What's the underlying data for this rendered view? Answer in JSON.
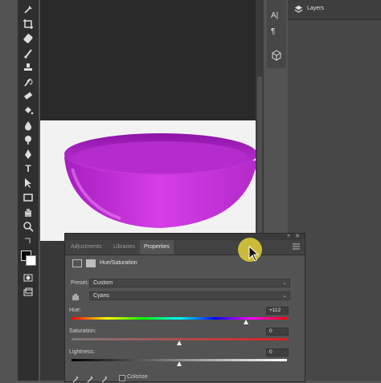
{
  "toolbar": {
    "tools": [
      "eyedropper-icon",
      "crop-icon",
      "healing-brush-icon",
      "brush-icon",
      "clone-stamp-icon",
      "history-brush-icon",
      "eraser-icon",
      "paint-bucket-icon",
      "blur-icon",
      "dodge-icon",
      "pen-icon",
      "type-icon",
      "path-selection-icon",
      "rectangle-icon",
      "hand-icon",
      "zoom-icon",
      "edit-toolbar-icon"
    ],
    "type_tool_glyph": "T"
  },
  "layers_panel": {
    "title": "Layers"
  },
  "icon_strip": {
    "glyph_a": "A|",
    "glyph_b": "¶"
  },
  "properties": {
    "tabs": [
      "Adjustments",
      "Libraries",
      "Properties"
    ],
    "active_tab": "Properties",
    "adjustment_title": "Hue/Saturation",
    "preset_label": "Preset:",
    "preset_value": "Custom",
    "channel_value": "Cyans",
    "hue": {
      "label": "Hue:",
      "value": "+112",
      "level_percent": 81
    },
    "saturation": {
      "label": "Saturation:",
      "value": "0",
      "level_percent": 50
    },
    "lightness": {
      "label": "Lightness:",
      "value": "0",
      "level_percent": 50
    },
    "colorize_label": "Colorize",
    "colorize_checked": false
  },
  "colors": {
    "bowl": "#c42fd8",
    "cursor_halo": "#d7c53a",
    "tab_active_text": "#e8e8e8"
  }
}
